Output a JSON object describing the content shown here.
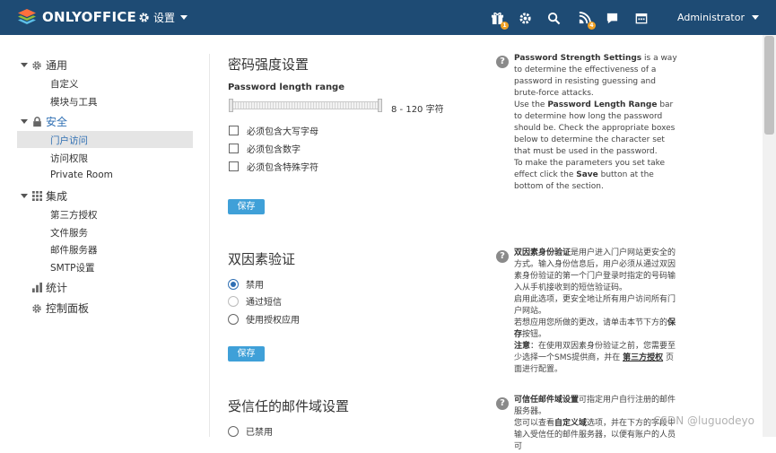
{
  "header": {
    "logo_text": "ONLYOFFICE",
    "settings_label": "设置",
    "user_name": "Administrator",
    "icons": [
      "gift-icon",
      "gear-icon",
      "search-icon",
      "feed-icon",
      "chat-icon",
      "calendar-icon"
    ],
    "gift_badge": "1",
    "feed_badge": "4"
  },
  "sidebar": {
    "groups": [
      {
        "label": "通用",
        "icon": "gear-icon",
        "items": [
          "自定义",
          "模块与工具"
        ]
      },
      {
        "label": "安全",
        "icon": "lock-icon",
        "items": [
          "门户访问",
          "访问权限",
          "Private Room"
        ]
      },
      {
        "label": "集成",
        "icon": "grid-icon",
        "items": [
          "第三方授权",
          "文件服务",
          "邮件服务器",
          "SMTP设置"
        ]
      },
      {
        "label": "统计",
        "icon": "bar-chart-icon",
        "items": []
      },
      {
        "label": "控制面板",
        "icon": "gear-icon",
        "items": []
      }
    ],
    "selected_item": "门户访问"
  },
  "password": {
    "title": "密码强度设置",
    "length_label": "Password length range",
    "range_text": "8 - 120 字符",
    "range_min": 8,
    "range_max": 120,
    "checks": [
      "必须包含大写字母",
      "必须包含数字",
      "必须包含特殊字符"
    ],
    "save_label": "保存",
    "help": {
      "p1_bold": "Password Strength Settings",
      "p1_rest": " is a way to determine the effectiveness of a password in resisting guessing and brute-force attacks.",
      "p2_pre": "Use the ",
      "p2_bold": "Password Length Range",
      "p2_rest": " bar to determine how long the password should be. Check the appropriate boxes below to determine the character set that must be used in the password.",
      "p3_pre": "To make the parameters you set take effect click the ",
      "p3_bold": "Save",
      "p3_rest": " button at the bottom of the section."
    }
  },
  "twofactor": {
    "title": "双因素验证",
    "options": [
      "禁用",
      "通过短信",
      "使用授权应用"
    ],
    "selected": "禁用",
    "save_label": "保存",
    "help": {
      "p1_bold": "双因素身份验证",
      "p1_rest": "是用户进入门户网站更安全的方式。输入身份信息后，用户必须从通过双因素身份验证的第一个门户登录时指定的号码输入从手机接收到的短信验证码。",
      "p2": "启用此选项，更安全地让所有用户访问所有门户网站。",
      "p3_pre": "若想应用您所做的更改，请单击本节下方的",
      "p3_bold": "保存",
      "p3_rest": "按钮。",
      "p4_bold": "注意",
      "p4_mid": "：在使用双因素身份验证之前，您需要至少选择一个SMS提供商，并在 ",
      "p4_bold2": "第三方授权",
      "p4_rest": " 页面进行配置。"
    }
  },
  "trusted": {
    "title": "受信任的邮件域设置",
    "first_option": "已禁用",
    "help": {
      "p1_bold": "可信任邮件域设置",
      "p1_rest": "可指定用户自行注册的邮件服务器。",
      "p2_pre": "您可以查看",
      "p2_bold": "自定义域",
      "p2_rest": "选项，并在下方的字段中输入受信任的邮件服务器，以便有账户的人员可"
    }
  },
  "watermark": "CSDN @luguodeyo",
  "colors": {
    "header_bg": "#1e4b74",
    "accent": "#2f6fb3",
    "button": "#3fa0d8"
  }
}
